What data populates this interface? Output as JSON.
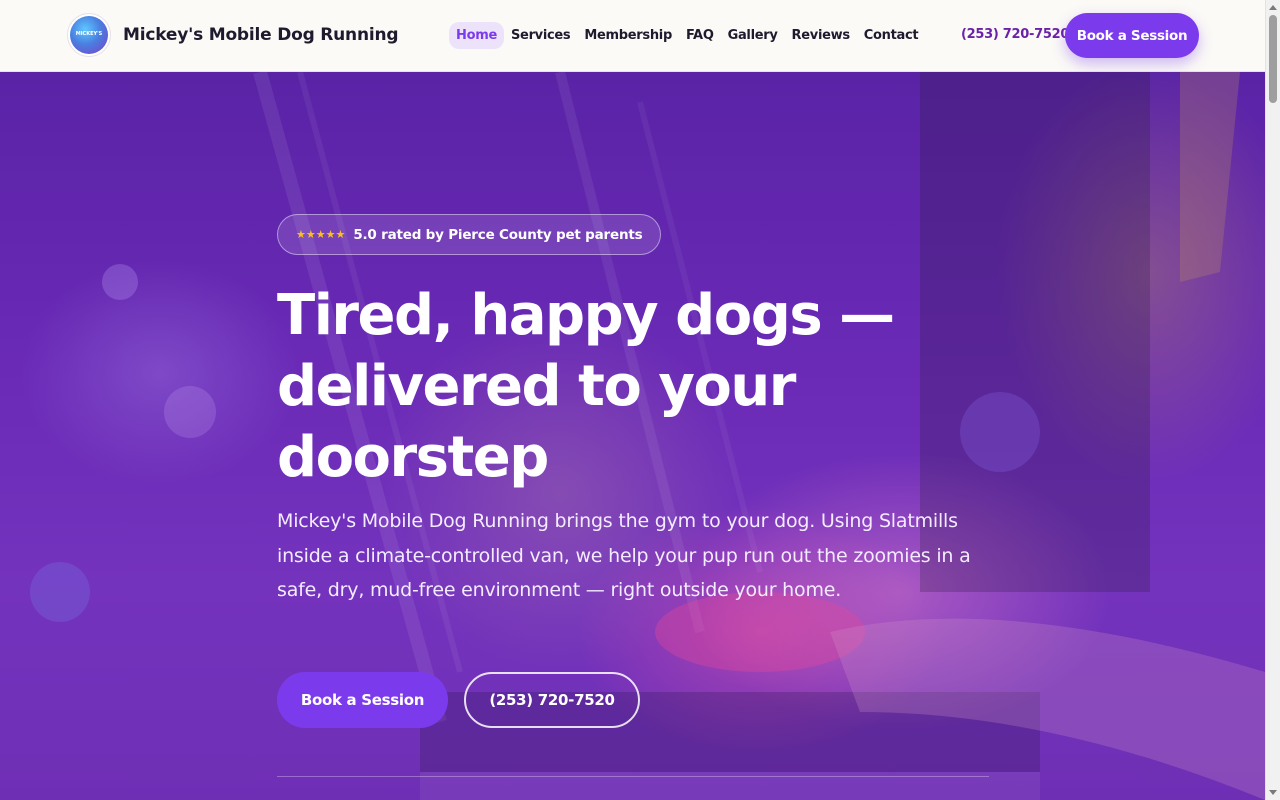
{
  "brand": {
    "name": "Mickey's Mobile Dog Running",
    "logo_text": "MICKEY'S"
  },
  "nav": {
    "items": [
      {
        "label": "Home",
        "active": true
      },
      {
        "label": "Services",
        "active": false
      },
      {
        "label": "Membership",
        "active": false
      },
      {
        "label": "FAQ",
        "active": false
      },
      {
        "label": "Gallery",
        "active": false
      },
      {
        "label": "Reviews",
        "active": false
      },
      {
        "label": "Contact",
        "active": false
      }
    ]
  },
  "header": {
    "phone": "(253) 720-7520",
    "cta_label": "Book a Session"
  },
  "hero": {
    "badge_stars": "★★★★★",
    "badge_text": "5.0 rated by Pierce County pet parents",
    "title": "Tired, happy dogs — delivered to your doorstep",
    "subtitle": "Mickey's Mobile Dog Running brings the gym to your dog. Using Slatmills inside a climate-controlled van, we help your pup run out the zoomies in a safe, dry, mud-free environment — right outside your home.",
    "primary_button": "Book a Session",
    "secondary_button": "(253) 720-7520"
  },
  "colors": {
    "accent": "#7c3aed",
    "phone_text": "#6b21a8",
    "hero_overlay": "#6d2fb0",
    "star": "#fbbf24"
  },
  "icons": {
    "logo": "dog-runner-logo",
    "rating": "star-icon"
  }
}
